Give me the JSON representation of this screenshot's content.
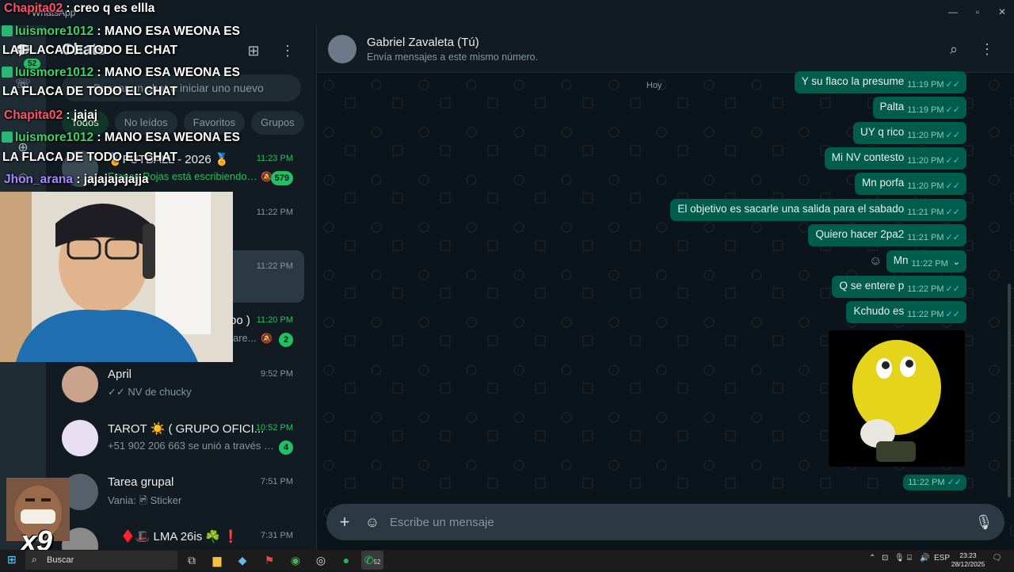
{
  "window": {
    "title": "WhatsApp",
    "minimize": "—",
    "maximize": "▫",
    "close": "✕"
  },
  "rail": {
    "badge": "52"
  },
  "chat_list": {
    "title": "Chats",
    "search_placeholder": "Buscar un chat o iniciar uno nuevo",
    "filters": [
      "Todos",
      "No leídos",
      "Favoritos",
      "Grupos"
    ],
    "items": [
      {
        "name": "🏅FUTBALL - 2026 🏅",
        "time": "11:23 PM",
        "preview": "Franco Rojas está escribiendo…",
        "count": "579",
        "muted": true,
        "unread": true
      },
      {
        "name": "",
        "time": "11:22 PM",
        "preview": "",
        "count": "",
        "muted": false,
        "unread": false
      },
      {
        "name": "",
        "time": "11:22 PM",
        "preview": "",
        "count": "",
        "muted": false,
        "unread": false
      },
      {
        "name": "po )",
        "time": "11:20 PM",
        "preview": "are...",
        "count": "2",
        "muted": true,
        "unread": true
      },
      {
        "name": "April",
        "time": "9:52 PM",
        "preview": "✓✓ NV de chucky",
        "count": "",
        "muted": false,
        "unread": false
      },
      {
        "name": "TAROT ☀️ ( GRUPO OFICI...",
        "time": "10:52 PM",
        "preview": "+51 902 206 663 se unió a través d...",
        "count": "4",
        "muted": false,
        "unread": true
      },
      {
        "name": "Tarea grupal",
        "time": "7:51 PM",
        "preview": "Vania: 🖻 Sticker",
        "count": "",
        "muted": false,
        "unread": false
      },
      {
        "name": "♦️🎩 LMA 26is ☘️ ❗",
        "time": "7:31 PM",
        "preview": "",
        "count": "",
        "muted": false,
        "unread": false
      }
    ]
  },
  "conversation": {
    "name": "Gabriel Zavaleta (Tú)",
    "subtitle": "Envía mensajes a este mismo número.",
    "day_label": "Hoy",
    "messages": [
      {
        "text": "Y su flaco la presume",
        "time": "11:19 PM"
      },
      {
        "text": "Palta",
        "time": "11:19 PM"
      },
      {
        "text": "UY q rico",
        "time": "11:20 PM"
      },
      {
        "text": "Mi NV contesto",
        "time": "11:20 PM"
      },
      {
        "text": "Mn porfa",
        "time": "11:20 PM"
      },
      {
        "text": "El objetivo es sacarle una salida para el sabado",
        "time": "11:21 PM"
      },
      {
        "text": "Quiero hacer 2pa2",
        "time": "11:21 PM"
      },
      {
        "text": "Mn",
        "time": "11:22 PM"
      },
      {
        "text": "Q se entere p",
        "time": "11:22 PM"
      },
      {
        "text": "Kchudo es",
        "time": "11:22 PM"
      }
    ],
    "sticker_time": "11:22 PM",
    "composer_placeholder": "Escribe un mensaje"
  },
  "stream_overlay": {
    "chat": [
      {
        "user": "Chapita02",
        "text": " : creo q es ellla"
      },
      {
        "user": "luismore1012",
        "text": " : MANO ESA WEONA ES"
      },
      {
        "user": "",
        "text": "LA FLACA DE TODO EL CHAT"
      },
      {
        "user": "luismore1012",
        "text": " : MANO ESA WEONA ES"
      },
      {
        "user": "",
        "text": "LA FLACA DE TODO EL CHAT"
      },
      {
        "user": "Chapita02",
        "text": " : jajaj"
      },
      {
        "user": "luismore1012",
        "text": " : MANO ESA WEONA ES"
      },
      {
        "user": "",
        "text": "LA FLACA DE TODO EL CHAT"
      },
      {
        "user": "Jhon_arana",
        "text": " : jajajajajajja"
      }
    ],
    "multiplier": "x9"
  },
  "taskbar": {
    "search_label": "Buscar",
    "whatsapp_badge": "52",
    "language": "ESP",
    "time": "23:23",
    "date": "28/12/2025"
  },
  "colors": {
    "accent": "#21c063",
    "outgoing": "#005c4b",
    "background": "#0b141a",
    "read_ticks": "#53bdeb"
  }
}
